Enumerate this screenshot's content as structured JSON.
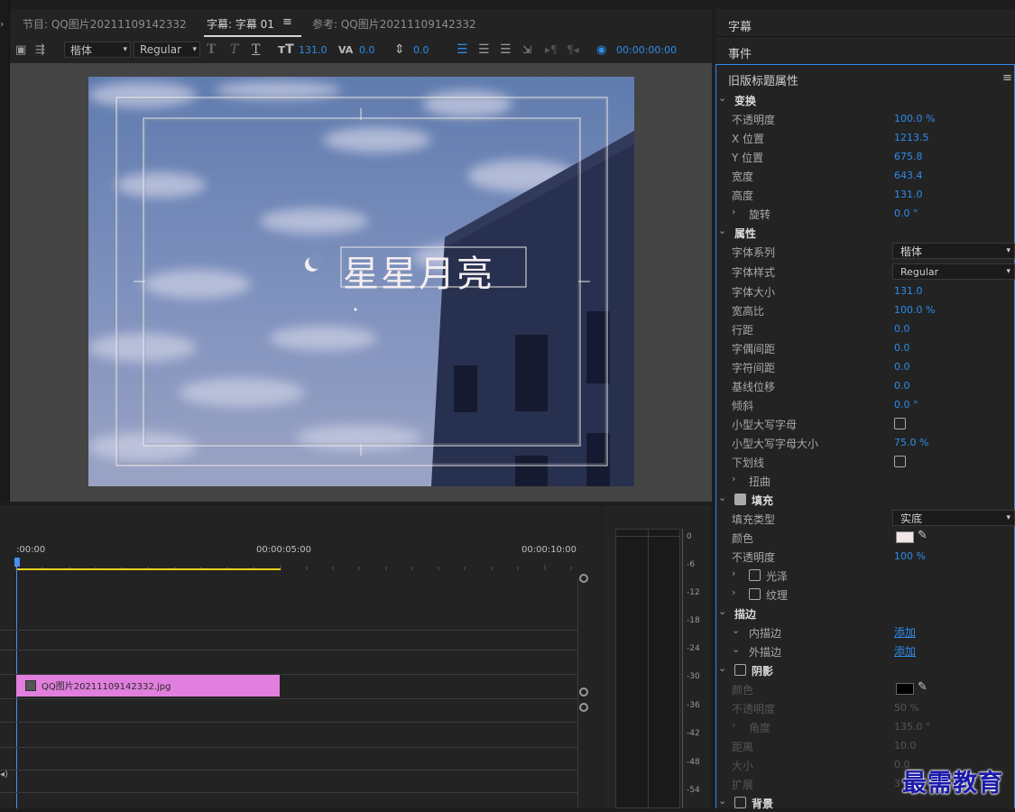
{
  "tabs": [
    {
      "label": "节目: QQ图片20211109142332"
    },
    {
      "label": "字幕: 字幕 01"
    },
    {
      "label": "参考: QQ图片20211109142332"
    }
  ],
  "toolbar": {
    "font_family": "楷体",
    "font_style": "Regular",
    "font_size": "131.0",
    "kerning": "0.0",
    "baseline": "0.0",
    "timecode": "00:00:00:00"
  },
  "canvas": {
    "title_text": "星星月亮"
  },
  "right_panel": {
    "top_items": [
      "字幕",
      "事件"
    ],
    "props_title": "旧版标题属性",
    "transform": {
      "header": "变换",
      "rows": [
        {
          "label": "不透明度",
          "value": "100.0 %"
        },
        {
          "label": "X 位置",
          "value": "1213.5"
        },
        {
          "label": "Y 位置",
          "value": "675.8"
        },
        {
          "label": "宽度",
          "value": "643.4"
        },
        {
          "label": "高度",
          "value": "131.0"
        },
        {
          "label": "旋转",
          "value": "0.0 °"
        }
      ]
    },
    "properties": {
      "header": "属性",
      "font_family_label": "字体系列",
      "font_family_value": "楷体",
      "font_style_label": "字体样式",
      "font_style_value": "Regular",
      "rows": [
        {
          "label": "字体大小",
          "value": "131.0"
        },
        {
          "label": "宽高比",
          "value": "100.0 %"
        },
        {
          "label": "行距",
          "value": "0.0"
        },
        {
          "label": "字偶间距",
          "value": "0.0"
        },
        {
          "label": "字符间距",
          "value": "0.0"
        },
        {
          "label": "基线位移",
          "value": "0.0"
        },
        {
          "label": "倾斜",
          "value": "0.0 °"
        }
      ],
      "small_caps_label": "小型大写字母",
      "small_caps_size_label": "小型大写字母大小",
      "small_caps_size_value": "75.0 %",
      "underline_label": "下划线",
      "distort_label": "扭曲"
    },
    "fill": {
      "header": "填充",
      "type_label": "填充类型",
      "type_value": "实底",
      "color_label": "颜色",
      "color": "#f2e6e6",
      "opacity_label": "不透明度",
      "opacity_value": "100 %",
      "sheen_label": "光泽",
      "texture_label": "纹理"
    },
    "stroke": {
      "header": "描边",
      "inner_label": "内描边",
      "outer_label": "外描边",
      "add_label": "添加"
    },
    "shadow": {
      "header": "阴影",
      "color_label": "颜色",
      "color": "#000000",
      "rows": [
        {
          "label": "不透明度",
          "value": "50 %"
        },
        {
          "label": "角度",
          "value": "135.0 °"
        },
        {
          "label": "距离",
          "value": "10.0"
        },
        {
          "label": "大小",
          "value": "0.0"
        },
        {
          "label": "扩展",
          "value": "3"
        }
      ]
    },
    "background": {
      "header": "背景"
    }
  },
  "timeline": {
    "ruler": [
      ":00:00",
      "00:00:05:00",
      "00:00:10:00"
    ],
    "clip_name": "QQ图片20211109142332.jpg"
  },
  "meter": {
    "ticks": [
      "0",
      "-6",
      "-12",
      "-18",
      "-24",
      "-30",
      "-36",
      "-42",
      "-48",
      "-54"
    ]
  },
  "watermark": "最需教育"
}
